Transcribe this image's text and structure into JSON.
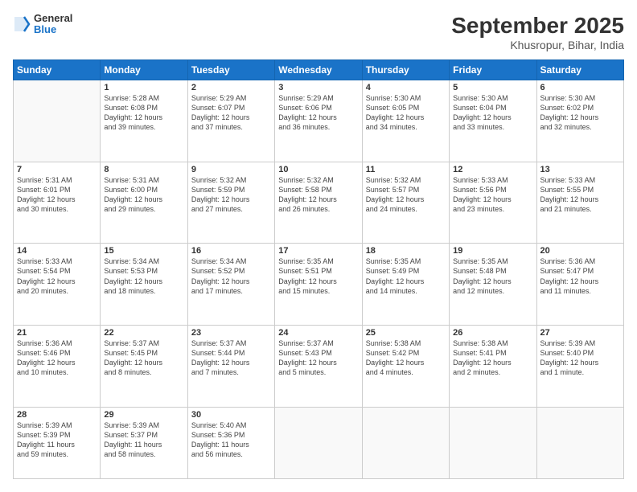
{
  "header": {
    "logo_line1": "General",
    "logo_line2": "Blue",
    "month": "September 2025",
    "location": "Khusropur, Bihar, India"
  },
  "weekdays": [
    "Sunday",
    "Monday",
    "Tuesday",
    "Wednesday",
    "Thursday",
    "Friday",
    "Saturday"
  ],
  "weeks": [
    [
      {
        "day": "",
        "info": ""
      },
      {
        "day": "1",
        "info": "Sunrise: 5:28 AM\nSunset: 6:08 PM\nDaylight: 12 hours\nand 39 minutes."
      },
      {
        "day": "2",
        "info": "Sunrise: 5:29 AM\nSunset: 6:07 PM\nDaylight: 12 hours\nand 37 minutes."
      },
      {
        "day": "3",
        "info": "Sunrise: 5:29 AM\nSunset: 6:06 PM\nDaylight: 12 hours\nand 36 minutes."
      },
      {
        "day": "4",
        "info": "Sunrise: 5:30 AM\nSunset: 6:05 PM\nDaylight: 12 hours\nand 34 minutes."
      },
      {
        "day": "5",
        "info": "Sunrise: 5:30 AM\nSunset: 6:04 PM\nDaylight: 12 hours\nand 33 minutes."
      },
      {
        "day": "6",
        "info": "Sunrise: 5:30 AM\nSunset: 6:02 PM\nDaylight: 12 hours\nand 32 minutes."
      }
    ],
    [
      {
        "day": "7",
        "info": "Sunrise: 5:31 AM\nSunset: 6:01 PM\nDaylight: 12 hours\nand 30 minutes."
      },
      {
        "day": "8",
        "info": "Sunrise: 5:31 AM\nSunset: 6:00 PM\nDaylight: 12 hours\nand 29 minutes."
      },
      {
        "day": "9",
        "info": "Sunrise: 5:32 AM\nSunset: 5:59 PM\nDaylight: 12 hours\nand 27 minutes."
      },
      {
        "day": "10",
        "info": "Sunrise: 5:32 AM\nSunset: 5:58 PM\nDaylight: 12 hours\nand 26 minutes."
      },
      {
        "day": "11",
        "info": "Sunrise: 5:32 AM\nSunset: 5:57 PM\nDaylight: 12 hours\nand 24 minutes."
      },
      {
        "day": "12",
        "info": "Sunrise: 5:33 AM\nSunset: 5:56 PM\nDaylight: 12 hours\nand 23 minutes."
      },
      {
        "day": "13",
        "info": "Sunrise: 5:33 AM\nSunset: 5:55 PM\nDaylight: 12 hours\nand 21 minutes."
      }
    ],
    [
      {
        "day": "14",
        "info": "Sunrise: 5:33 AM\nSunset: 5:54 PM\nDaylight: 12 hours\nand 20 minutes."
      },
      {
        "day": "15",
        "info": "Sunrise: 5:34 AM\nSunset: 5:53 PM\nDaylight: 12 hours\nand 18 minutes."
      },
      {
        "day": "16",
        "info": "Sunrise: 5:34 AM\nSunset: 5:52 PM\nDaylight: 12 hours\nand 17 minutes."
      },
      {
        "day": "17",
        "info": "Sunrise: 5:35 AM\nSunset: 5:51 PM\nDaylight: 12 hours\nand 15 minutes."
      },
      {
        "day": "18",
        "info": "Sunrise: 5:35 AM\nSunset: 5:49 PM\nDaylight: 12 hours\nand 14 minutes."
      },
      {
        "day": "19",
        "info": "Sunrise: 5:35 AM\nSunset: 5:48 PM\nDaylight: 12 hours\nand 12 minutes."
      },
      {
        "day": "20",
        "info": "Sunrise: 5:36 AM\nSunset: 5:47 PM\nDaylight: 12 hours\nand 11 minutes."
      }
    ],
    [
      {
        "day": "21",
        "info": "Sunrise: 5:36 AM\nSunset: 5:46 PM\nDaylight: 12 hours\nand 10 minutes."
      },
      {
        "day": "22",
        "info": "Sunrise: 5:37 AM\nSunset: 5:45 PM\nDaylight: 12 hours\nand 8 minutes."
      },
      {
        "day": "23",
        "info": "Sunrise: 5:37 AM\nSunset: 5:44 PM\nDaylight: 12 hours\nand 7 minutes."
      },
      {
        "day": "24",
        "info": "Sunrise: 5:37 AM\nSunset: 5:43 PM\nDaylight: 12 hours\nand 5 minutes."
      },
      {
        "day": "25",
        "info": "Sunrise: 5:38 AM\nSunset: 5:42 PM\nDaylight: 12 hours\nand 4 minutes."
      },
      {
        "day": "26",
        "info": "Sunrise: 5:38 AM\nSunset: 5:41 PM\nDaylight: 12 hours\nand 2 minutes."
      },
      {
        "day": "27",
        "info": "Sunrise: 5:39 AM\nSunset: 5:40 PM\nDaylight: 12 hours\nand 1 minute."
      }
    ],
    [
      {
        "day": "28",
        "info": "Sunrise: 5:39 AM\nSunset: 5:39 PM\nDaylight: 11 hours\nand 59 minutes."
      },
      {
        "day": "29",
        "info": "Sunrise: 5:39 AM\nSunset: 5:37 PM\nDaylight: 11 hours\nand 58 minutes."
      },
      {
        "day": "30",
        "info": "Sunrise: 5:40 AM\nSunset: 5:36 PM\nDaylight: 11 hours\nand 56 minutes."
      },
      {
        "day": "",
        "info": ""
      },
      {
        "day": "",
        "info": ""
      },
      {
        "day": "",
        "info": ""
      },
      {
        "day": "",
        "info": ""
      }
    ]
  ]
}
